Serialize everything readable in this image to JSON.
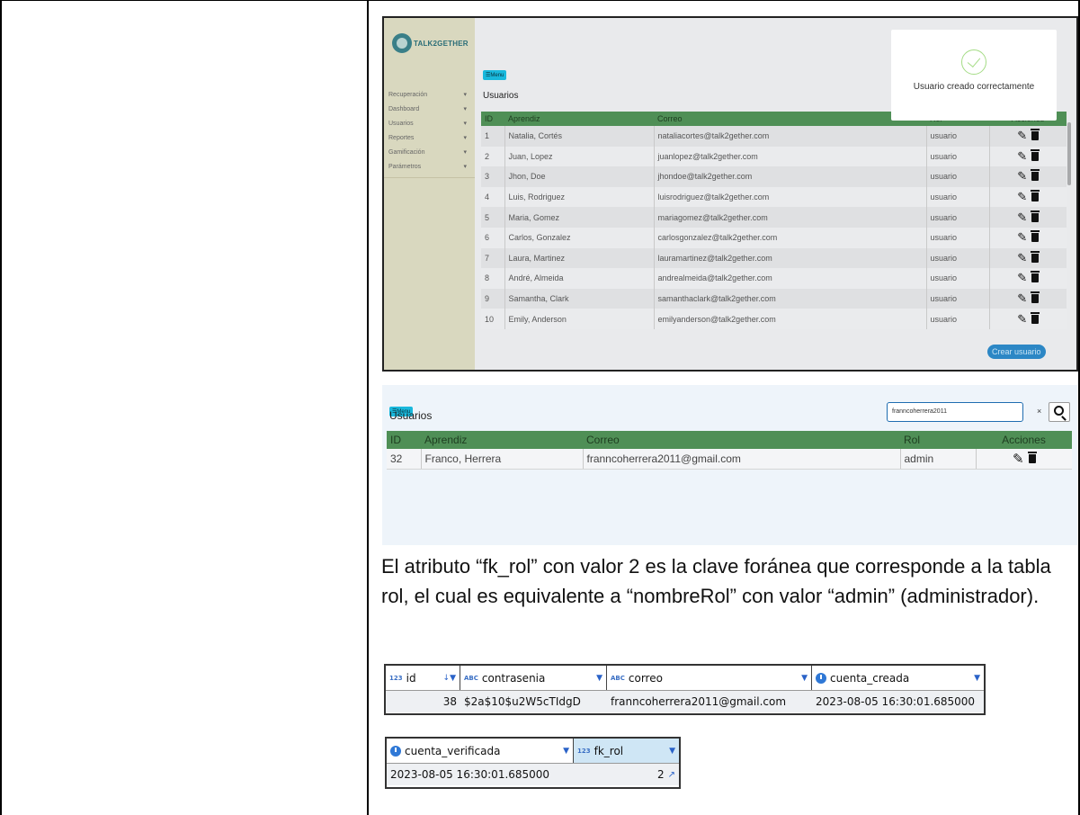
{
  "shot1": {
    "logo_text": "TALK2GETHER",
    "menu_label": "☰Menu",
    "title": "Usuarios",
    "nav": [
      {
        "label": "Recuperación"
      },
      {
        "label": "Dashboard"
      },
      {
        "label": "Usuarios"
      },
      {
        "label": "Reportes"
      },
      {
        "label": "Gamificación"
      },
      {
        "label": "Parámetros"
      }
    ],
    "columns": {
      "id": "ID",
      "aprendiz": "Aprendiz",
      "correo": "Correo",
      "rol": "Rol",
      "acciones": "Acciones"
    },
    "rows": [
      {
        "id": "1",
        "aprendiz": "Natalia, Cortés",
        "correo": "nataliacortes@talk2gether.com",
        "rol": "usuario"
      },
      {
        "id": "2",
        "aprendiz": "Juan, Lopez",
        "correo": "juanlopez@talk2gether.com",
        "rol": "usuario"
      },
      {
        "id": "3",
        "aprendiz": "Jhon, Doe",
        "correo": "jhondoe@talk2gether.com",
        "rol": "usuario"
      },
      {
        "id": "4",
        "aprendiz": "Luis, Rodriguez",
        "correo": "luisrodriguez@talk2gether.com",
        "rol": "usuario"
      },
      {
        "id": "5",
        "aprendiz": "Maria, Gomez",
        "correo": "mariagomez@talk2gether.com",
        "rol": "usuario"
      },
      {
        "id": "6",
        "aprendiz": "Carlos, Gonzalez",
        "correo": "carlosgonzalez@talk2gether.com",
        "rol": "usuario"
      },
      {
        "id": "7",
        "aprendiz": "Laura, Martinez",
        "correo": "lauramartinez@talk2gether.com",
        "rol": "usuario"
      },
      {
        "id": "8",
        "aprendiz": "André, Almeida",
        "correo": "andrealmeida@talk2gether.com",
        "rol": "usuario"
      },
      {
        "id": "9",
        "aprendiz": "Samantha, Clark",
        "correo": "samanthaclark@talk2gether.com",
        "rol": "usuario"
      },
      {
        "id": "10",
        "aprendiz": "Emily, Anderson",
        "correo": "emilyanderson@talk2gether.com",
        "rol": "usuario"
      }
    ],
    "create_button": "Crear usuario",
    "toast": {
      "message": "Usuario creado correctamente",
      "icon": "check-circle-icon"
    }
  },
  "shot2": {
    "menu_label": "☰Menu",
    "title": "Usuarios",
    "search_value": "franncoherrera2011",
    "clear_label": "×",
    "columns": {
      "id": "ID",
      "aprendiz": "Aprendiz",
      "correo": "Correo",
      "rol": "Rol",
      "acciones": "Acciones"
    },
    "rows": [
      {
        "id": "32",
        "aprendiz": "Franco, Herrera",
        "correo": "franncoherrera2011@gmail.com",
        "rol": "admin"
      }
    ]
  },
  "paragraph": "El atributo “fk_rol” con valor 2 es  la clave foránea que corresponde a la tabla rol, el cual es equivalente a “nombreRol” con valor “admin” (administrador).",
  "db_grid1": {
    "columns": [
      {
        "type": "123",
        "name": "id"
      },
      {
        "type": "ABC",
        "name": "contrasenia"
      },
      {
        "type": "ABC",
        "name": "correo"
      },
      {
        "type": "clock",
        "name": "cuenta_creada"
      }
    ],
    "row": {
      "id": "38",
      "contrasenia": "$2a$10$u2W5cTIdgD",
      "correo": "franncoherrera2011@gmail.com",
      "cuenta_creada": "2023-08-05 16:30:01.685000"
    }
  },
  "db_grid2": {
    "columns": [
      {
        "type": "clock",
        "name": "cuenta_verificada"
      },
      {
        "type": "123",
        "name": "fk_rol"
      }
    ],
    "row": {
      "cuenta_verificada": "2023-08-05 16:30:01.685000",
      "fk_rol": "2"
    }
  }
}
